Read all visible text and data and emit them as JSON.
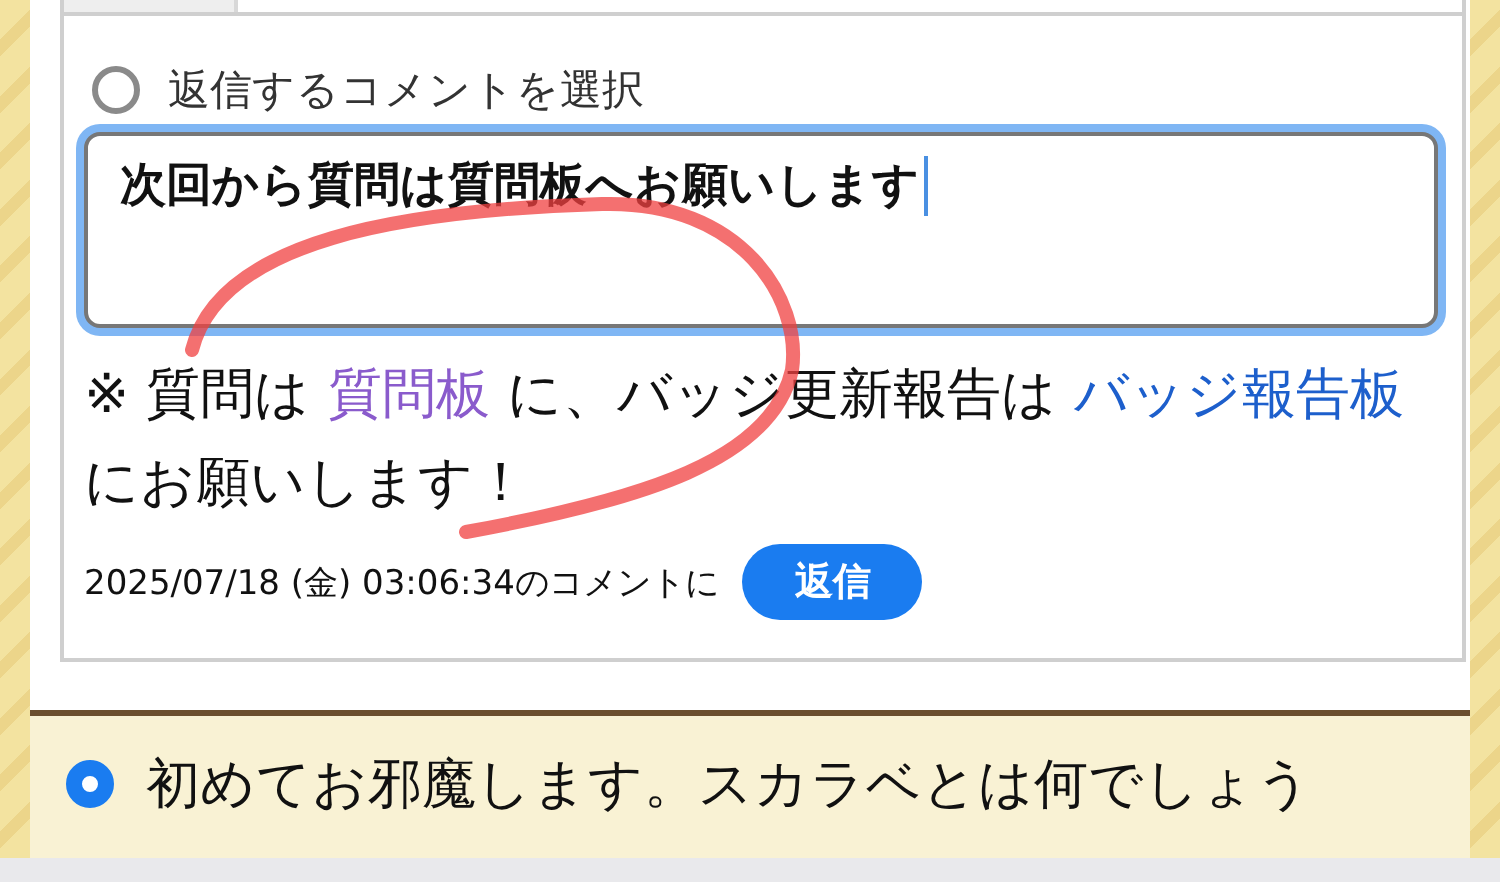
{
  "reply_form": {
    "select_label": "返信するコメントを選択",
    "select_checked": false,
    "comment_value": "次回から質問は質問板へお願いします",
    "notice": [
      {
        "kind": "text",
        "text": "※ 質問は "
      },
      {
        "kind": "link",
        "text": "質問板",
        "visited": true
      },
      {
        "kind": "text",
        "text": " に、バッジ更新報告は "
      },
      {
        "kind": "link",
        "text": "バッジ報告板",
        "visited": false
      },
      {
        "kind": "text",
        "text": " にお願いします！"
      }
    ],
    "reply_target": "2025/07/18 (金) 03:06:34のコメントに",
    "reply_button": "返信"
  },
  "comments": [
    {
      "text": "初めてお邪魔します。スカラベとは何でしょう",
      "selected": true
    }
  ]
}
